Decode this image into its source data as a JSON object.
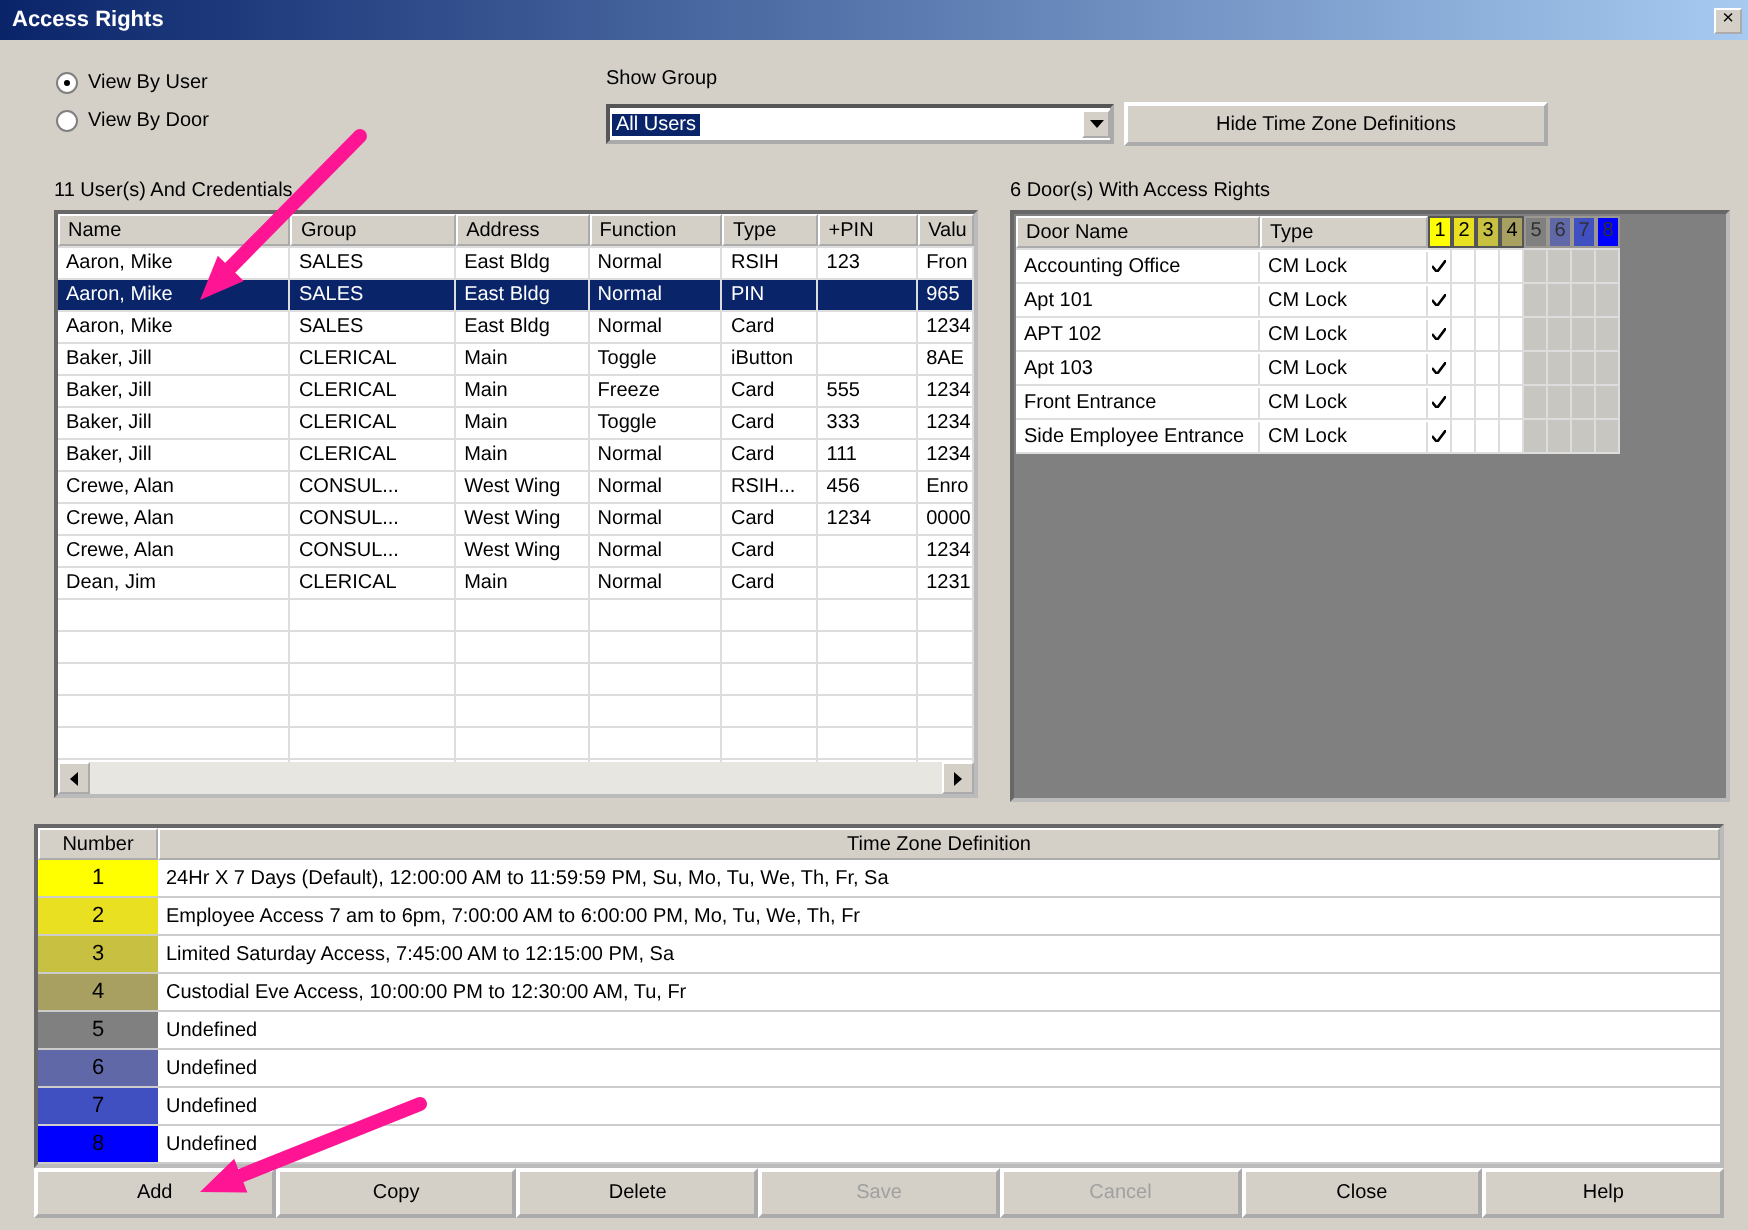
{
  "window": {
    "title": "Access Rights",
    "close": "×"
  },
  "view_options": [
    {
      "label": "View By User",
      "selected": true
    },
    {
      "label": "View By Door",
      "selected": false
    }
  ],
  "show_group": {
    "label": "Show Group",
    "value": "All Users"
  },
  "hide_button": "Hide Time Zone Definitions",
  "users": {
    "title": "11 User(s) And Credentials",
    "columns": [
      "Name",
      "Group",
      "Address",
      "Function",
      "Type",
      "+PIN",
      "Valu"
    ],
    "rows": [
      {
        "cells": [
          "Aaron, Mike",
          "SALES",
          "East Bldg",
          "Normal",
          "RSIH",
          "123",
          "Fron"
        ],
        "selected": false
      },
      {
        "cells": [
          "Aaron, Mike",
          "SALES",
          "East Bldg",
          "Normal",
          "PIN",
          "",
          "965"
        ],
        "selected": true
      },
      {
        "cells": [
          "Aaron, Mike",
          "SALES",
          "East Bldg",
          "Normal",
          "Card",
          "",
          "1234"
        ],
        "selected": false
      },
      {
        "cells": [
          "Baker, Jill",
          "CLERICAL",
          "Main",
          "Toggle",
          "iButton",
          "",
          "8AE"
        ],
        "selected": false
      },
      {
        "cells": [
          "Baker, Jill",
          "CLERICAL",
          "Main",
          "Freeze",
          "Card",
          "555",
          "1234"
        ],
        "selected": false
      },
      {
        "cells": [
          "Baker, Jill",
          "CLERICAL",
          "Main",
          "Toggle",
          "Card",
          "333",
          "1234"
        ],
        "selected": false
      },
      {
        "cells": [
          "Baker, Jill",
          "CLERICAL",
          "Main",
          "Normal",
          "Card",
          "111",
          "1234"
        ],
        "selected": false
      },
      {
        "cells": [
          "Crewe, Alan",
          "CONSUL...",
          "West Wing",
          "Normal",
          "RSIH...",
          "456",
          "Enro"
        ],
        "selected": false
      },
      {
        "cells": [
          "Crewe, Alan",
          "CONSUL...",
          "West Wing",
          "Normal",
          "Card",
          "1234",
          "0000"
        ],
        "selected": false
      },
      {
        "cells": [
          "Crewe, Alan",
          "CONSUL...",
          "West Wing",
          "Normal",
          "Card",
          "",
          "1234"
        ],
        "selected": false
      },
      {
        "cells": [
          "Dean, Jim",
          "CLERICAL",
          "Main",
          "Normal",
          "Card",
          "",
          "1231"
        ],
        "selected": false
      }
    ]
  },
  "doors": {
    "title": "6 Door(s) With Access Rights",
    "columns": [
      "Door Name",
      "Type"
    ],
    "zone_headers": [
      {
        "number": "1",
        "color": "#ffff00",
        "defined": true
      },
      {
        "number": "2",
        "color": "#e8e020",
        "defined": true
      },
      {
        "number": "3",
        "color": "#c8c040",
        "defined": true
      },
      {
        "number": "4",
        "color": "#a8a060",
        "defined": true
      },
      {
        "number": "5",
        "color": "#808080",
        "defined": false
      },
      {
        "number": "6",
        "color": "#6068a8",
        "defined": false
      },
      {
        "number": "7",
        "color": "#4050c0",
        "defined": false
      },
      {
        "number": "8",
        "color": "#0000ff",
        "defined": false
      }
    ],
    "rows": [
      {
        "name": "Accounting Office",
        "type": "CM Lock",
        "zones": [
          {
            "checked": true
          },
          {
            "checked": false
          },
          {
            "checked": false
          },
          {
            "checked": false
          },
          {
            "checked": false
          },
          {
            "checked": false
          },
          {
            "checked": false
          },
          {
            "checked": false
          }
        ]
      },
      {
        "name": "Apt 101",
        "type": "CM Lock",
        "zones": [
          {
            "checked": true
          },
          {
            "checked": false
          },
          {
            "checked": false
          },
          {
            "checked": false
          },
          {
            "checked": false
          },
          {
            "checked": false
          },
          {
            "checked": false
          },
          {
            "checked": false
          }
        ]
      },
      {
        "name": "APT 102",
        "type": "CM Lock",
        "zones": [
          {
            "checked": true
          },
          {
            "checked": false
          },
          {
            "checked": false
          },
          {
            "checked": false
          },
          {
            "checked": false
          },
          {
            "checked": false
          },
          {
            "checked": false
          },
          {
            "checked": false
          }
        ]
      },
      {
        "name": "Apt 103",
        "type": "CM Lock",
        "zones": [
          {
            "checked": true
          },
          {
            "checked": false
          },
          {
            "checked": false
          },
          {
            "checked": false
          },
          {
            "checked": false
          },
          {
            "checked": false
          },
          {
            "checked": false
          },
          {
            "checked": false
          }
        ]
      },
      {
        "name": "Front Entrance",
        "type": "CM Lock",
        "zones": [
          {
            "checked": true
          },
          {
            "checked": false
          },
          {
            "checked": false
          },
          {
            "checked": false
          },
          {
            "checked": false
          },
          {
            "checked": false
          },
          {
            "checked": false
          },
          {
            "checked": false
          }
        ]
      },
      {
        "name": "Side Employee Entrance",
        "type": "CM Lock",
        "zones": [
          {
            "checked": true
          },
          {
            "checked": false
          },
          {
            "checked": false
          },
          {
            "checked": false
          },
          {
            "checked": false
          },
          {
            "checked": false
          },
          {
            "checked": false
          },
          {
            "checked": false
          }
        ]
      }
    ]
  },
  "time_zones": {
    "columns": [
      "Number",
      "Time Zone Definition"
    ],
    "rows": [
      {
        "number": "1",
        "color": "#ffff00",
        "definition": "24Hr X 7 Days (Default), 12:00:00 AM to 11:59:59 PM, Su, Mo, Tu, We, Th, Fr, Sa"
      },
      {
        "number": "2",
        "color": "#e8e020",
        "definition": "Employee Access 7 am to 6pm, 7:00:00 AM to 6:00:00 PM, Mo, Tu, We, Th, Fr"
      },
      {
        "number": "3",
        "color": "#c8c040",
        "definition": "Limited Saturday Access, 7:45:00 AM to 12:15:00 PM, Sa"
      },
      {
        "number": "4",
        "color": "#a8a060",
        "definition": "Custodial Eve Access, 10:00:00 PM to 12:30:00 AM, Tu, Fr"
      },
      {
        "number": "5",
        "color": "#808080",
        "definition": "Undefined"
      },
      {
        "number": "6",
        "color": "#6068a8",
        "definition": "Undefined"
      },
      {
        "number": "7",
        "color": "#4050c0",
        "definition": "Undefined"
      },
      {
        "number": "8",
        "color": "#0000ff",
        "definition": "Undefined"
      }
    ]
  },
  "buttons": [
    {
      "label": "Add",
      "disabled": false
    },
    {
      "label": "Copy",
      "disabled": false
    },
    {
      "label": "Delete",
      "disabled": false
    },
    {
      "label": "Save",
      "disabled": true
    },
    {
      "label": "Cancel",
      "disabled": true
    },
    {
      "label": "Close",
      "disabled": false
    },
    {
      "label": "Help",
      "disabled": false
    }
  ]
}
